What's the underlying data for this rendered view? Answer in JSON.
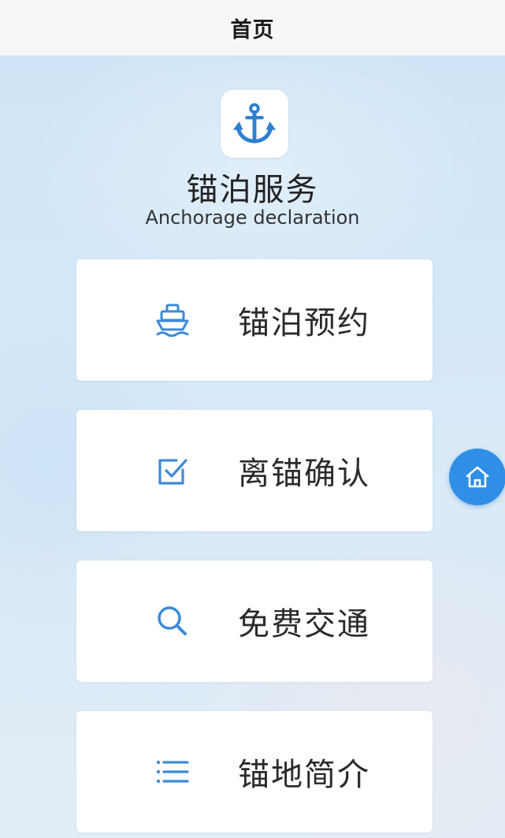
{
  "header": {
    "title": "首页"
  },
  "brand": {
    "logo_icon": "anchor-icon",
    "title": "锚泊服务",
    "subtitle": "Anchorage declaration"
  },
  "menu": {
    "items": [
      {
        "label": "锚泊预约",
        "icon": "ship-icon"
      },
      {
        "label": "离锚确认",
        "icon": "checkbox-icon"
      },
      {
        "label": "免费交通",
        "icon": "search-icon"
      },
      {
        "label": "锚地简介",
        "icon": "list-icon"
      }
    ]
  },
  "floating": {
    "home_icon": "home-icon"
  },
  "colors": {
    "accent": "#2f8fe6",
    "icon_blue": "#3d8bd6",
    "card_bg": "#ffffff",
    "page_bg": "#d7e9f8"
  }
}
